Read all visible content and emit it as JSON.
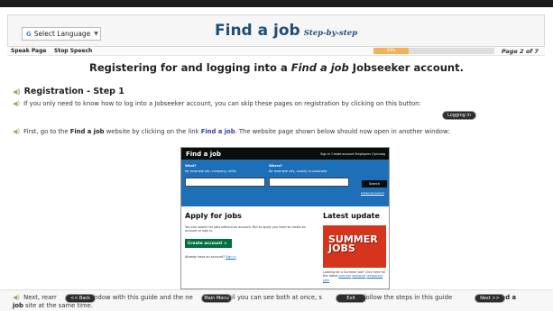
{
  "language": {
    "label": "Select Language",
    "g": "G",
    "arrow": "▼"
  },
  "brand": {
    "title": "Find a job",
    "subtitle": "Step-by-step"
  },
  "toolbar": {
    "speak": "Speak Page",
    "stop": "Stop Speech",
    "progress_label": "29%",
    "progress_value": 0.29,
    "page": "Page 2 of 7"
  },
  "heading": {
    "pre": "Registering for and logging into a ",
    "em": "Find a job",
    "post": " Jobseeker account."
  },
  "step": {
    "title": "Registration - Step 1"
  },
  "para1": "If you only need to know how to log into a Jobseeker account, you can skip these pages on registration by clicking on this button:",
  "para2": {
    "pre": "First, go to the ",
    "b": "Find a job",
    "mid": " website by clicking on the link ",
    "link": "Find a job",
    "post": ". The website page shown below should now open in another window:"
  },
  "para3": {
    "pre": "Next, rearr",
    "a": "window with this guide and the ne",
    "b": "until you can see both at once, s",
    "c": "can follow the steps in this guide",
    "d": "the ",
    "bold": "Find a",
    "e": "job",
    "f": " site at the same time."
  },
  "buttons": {
    "login": "Logging in",
    "back": "<< Back",
    "menu": "Main Menu",
    "exit": "Exit",
    "next": "Next >>"
  },
  "screenshot": {
    "logo": "Find a job",
    "links": "Sign in   Create account   Employers   Cymraeg",
    "what": "What?",
    "what_hint": "for example job, company, skills",
    "where": "Where?",
    "where_hint": "for example city, county or postcode",
    "search": "Search",
    "advanced": "Advanced search",
    "apply_title": "Apply for jobs",
    "apply_text": "You can search for jobs without an account. But to apply you need to create an account or sign in.",
    "create": "Create account  >",
    "already": "Already have an account?",
    "signin": "Sign in",
    "latest": "Latest update",
    "promo": "SUMMER JOBS",
    "promo_text": "Looking for a Summer job? Click here for the latest",
    "promo_link1": "summer",
    "promo_link2": "seasonal",
    "promo_link3": "temporary jobs"
  },
  "colors": {
    "brand": "#1f4e79",
    "link": "#2e3fa8",
    "gov_blue": "#1d70b8",
    "green": "#00703c",
    "red": "#d4351c"
  },
  "icons": {
    "speaker": "speaker-icon"
  }
}
